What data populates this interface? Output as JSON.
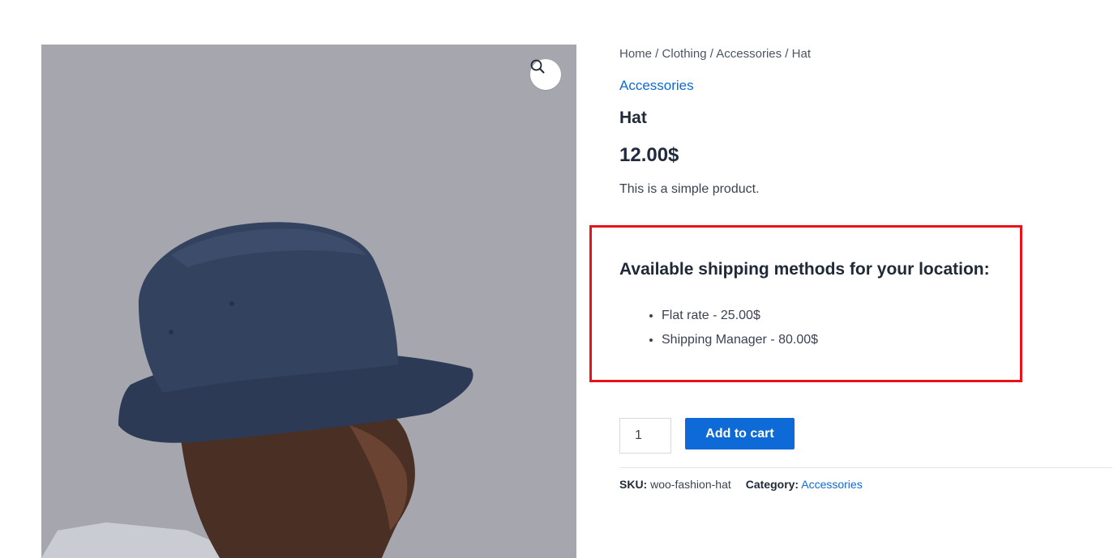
{
  "breadcrumb": {
    "home": "Home",
    "sep1": " / ",
    "clothing": "Clothing",
    "sep2": " / ",
    "accessories": "Accessories",
    "sep3": " / ",
    "current": "Hat"
  },
  "product": {
    "category_link": "Accessories",
    "title": "Hat",
    "price": "12.00$",
    "description": "This is a simple product.",
    "image_alt": "Man wearing navy bucket hat"
  },
  "shipping": {
    "heading": "Available shipping methods for your location:",
    "methods": [
      "Flat rate - 25.00$",
      "Shipping Manager - 80.00$"
    ]
  },
  "cart": {
    "quantity": "1",
    "add_label": "Add to cart"
  },
  "meta": {
    "sku_label": "SKU:",
    "sku_value": "woo-fashion-hat",
    "category_label": "Category:",
    "category_value": "Accessories"
  },
  "colors": {
    "accent": "#0d6ad6",
    "highlight_border": "#e8121a",
    "image_background": "#a7a7b0"
  },
  "icons": {
    "zoom": "magnifier-icon"
  }
}
